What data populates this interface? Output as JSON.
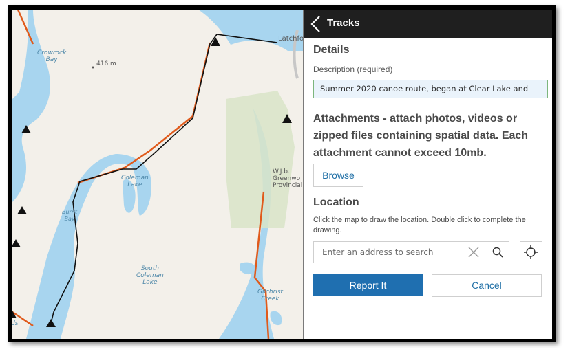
{
  "map": {
    "labels": {
      "crowrock_bay": "Crowrock\nBay",
      "elevation": "416 m",
      "latchford": "Latchfo",
      "coleman_lake": "Coleman\nLake",
      "burnt_bay": "Burnt\nBay",
      "south_coleman_lake": "South\nColeman\nLake",
      "park": "W.J.b.\nGreenwo\nProvincial",
      "gilchrist_creek": "Gilchrist\nCreek",
      "edge_fragment": "ds"
    },
    "colors": {
      "water": "#a8d5ef",
      "land": "#f3f0ea",
      "park": "#d8e4c8",
      "route": "#e05a1b",
      "track": "#111111"
    }
  },
  "panel": {
    "header": {
      "title": "Tracks"
    },
    "details_heading": "Details",
    "description": {
      "label": "Description (required)",
      "value": "Summer 2020 canoe route, began at Clear Lake and"
    },
    "attachments_heading": "Attachments - attach photos, videos or zipped files containing spatial data. Each attachment cannot exceed 10mb.",
    "browse_label": "Browse",
    "location_heading": "Location",
    "location_help": "Click the map to draw the location. Double click to complete the drawing.",
    "search": {
      "placeholder": "Enter an address to search"
    },
    "report_label": "Report It",
    "cancel_label": "Cancel"
  },
  "icons": [
    "back-chevron-icon",
    "clear-x-icon",
    "search-icon",
    "crosshair-locate-icon",
    "campsite-icon"
  ]
}
